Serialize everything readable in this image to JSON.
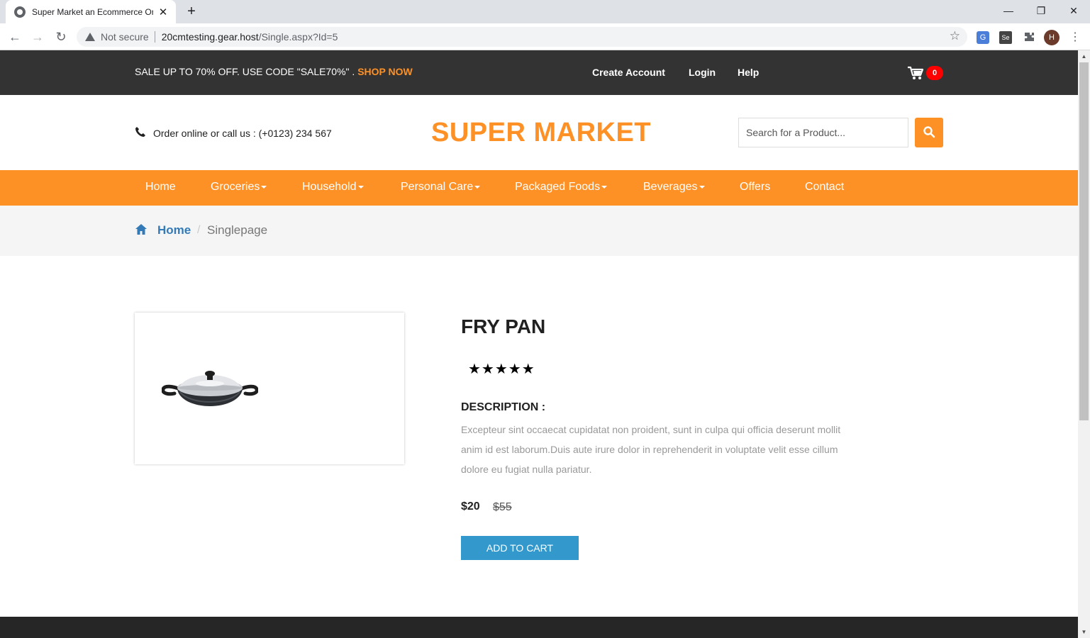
{
  "browser": {
    "tab_title": "Super Market an Ecommerce Onl",
    "tab_close": "✕",
    "new_tab": "+",
    "security_label": "Not secure",
    "url_host": "20cmtesting.gear.host",
    "url_path": "/Single.aspx?Id=5",
    "profile_initial": "H"
  },
  "topbar": {
    "promo_text": "SALE UP TO 70% OFF. USE CODE \"SALE70%\" . ",
    "promo_link": "SHOP NOW",
    "links": [
      "Create Account",
      "Login",
      "Help"
    ],
    "cart_count": "0"
  },
  "header": {
    "phone_text": "Order online or call us : (+0123) 234 567",
    "brand": "SUPER MARKET",
    "search_placeholder": "Search for a Product..."
  },
  "nav": {
    "items": [
      {
        "label": "Home"
      },
      {
        "label": "Groceries"
      },
      {
        "label": "Household"
      },
      {
        "label": "Personal Care"
      },
      {
        "label": "Packaged Foods"
      },
      {
        "label": "Beverages"
      },
      {
        "label": "Offers"
      },
      {
        "label": "Contact"
      }
    ]
  },
  "breadcrumb": {
    "home": "Home",
    "separator": "/",
    "current": "Singlepage"
  },
  "product": {
    "name": "FRY PAN",
    "stars": "★★★★★",
    "rating": 5,
    "description_label": "DESCRIPTION :",
    "description": "Excepteur sint occaecat cupidatat non proident, sunt in culpa qui officia deserunt mollit anim id est laborum.Duis aute irure dolor in reprehenderit in voluptate velit esse cillum dolore eu fugiat nulla pariatur.",
    "price": "$20",
    "old_price": "$55",
    "add_to_cart": "ADD TO CART"
  },
  "colors": {
    "accent": "#fe9126",
    "topbar": "#333333",
    "link": "#337ab7",
    "button": "#3399cc",
    "badge": "#ff0000"
  }
}
